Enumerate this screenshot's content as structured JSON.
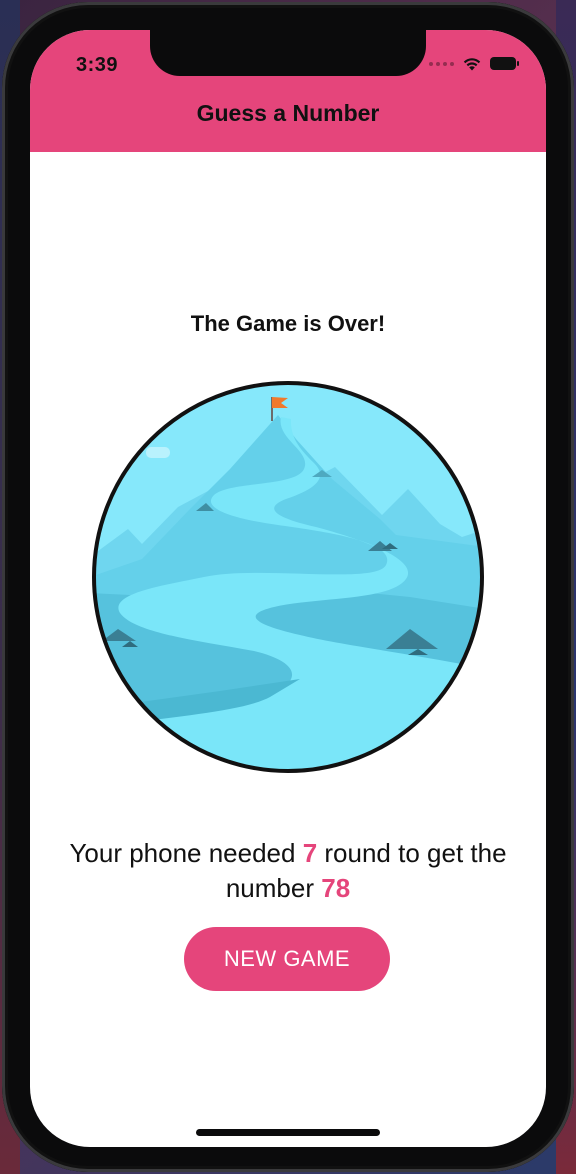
{
  "status": {
    "time": "3:39",
    "wifi_icon": "wifi-icon",
    "battery_icon": "battery-icon"
  },
  "header": {
    "title": "Guess a Number",
    "background": "#e5457b"
  },
  "main": {
    "heading": "The Game is Over!",
    "illustration_icon": "mountain-summit-icon",
    "result": {
      "prefix": "Your phone needed ",
      "rounds": "7",
      "middle": " round to get the number ",
      "number": "78"
    },
    "new_game_label": "NEW GAME"
  },
  "colors": {
    "accent": "#e5457b",
    "sky": "#7fe3f7",
    "mountain": "#5ccae6",
    "river": "#79e6f8"
  }
}
